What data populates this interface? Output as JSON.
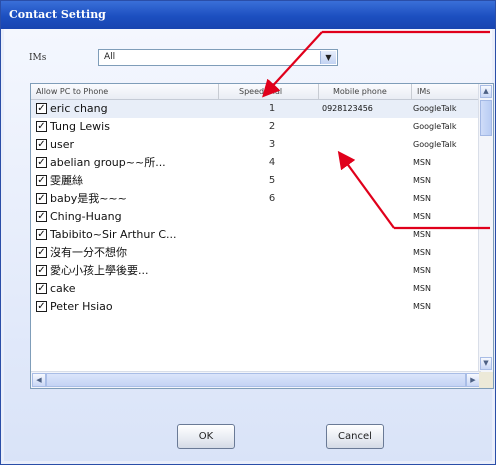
{
  "window": {
    "title": "Contact Setting"
  },
  "ims_filter": {
    "label": "IMs",
    "value": "All"
  },
  "list": {
    "columns": {
      "allow": "Allow PC to Phone",
      "speed_dial": "Speed Dial",
      "mobile": "Mobile phone",
      "ims": "IMs"
    },
    "rows": [
      {
        "name": "eric chang",
        "speed_dial": "1",
        "mobile": "0928123456",
        "ims": "GoogleTalk",
        "checked": true,
        "selected": true
      },
      {
        "name": "Tung Lewis",
        "speed_dial": "2",
        "mobile": "",
        "ims": "GoogleTalk",
        "checked": true,
        "selected": false
      },
      {
        "name": "user",
        "speed_dial": "3",
        "mobile": "",
        "ims": "GoogleTalk",
        "checked": true,
        "selected": false
      },
      {
        "name": "abelian group~~所...",
        "speed_dial": "4",
        "mobile": "",
        "ims": "MSN",
        "checked": true,
        "selected": false
      },
      {
        "name": "雯麗絲",
        "speed_dial": "5",
        "mobile": "",
        "ims": "MSN",
        "checked": true,
        "selected": false
      },
      {
        "name": "baby是我~~~",
        "speed_dial": "6",
        "mobile": "",
        "ims": "MSN",
        "checked": true,
        "selected": false
      },
      {
        "name": "Ching-Huang",
        "speed_dial": "",
        "mobile": "",
        "ims": "MSN",
        "checked": true,
        "selected": false
      },
      {
        "name": "Tabibito~Sir Arthur C...",
        "speed_dial": "",
        "mobile": "",
        "ims": "MSN",
        "checked": true,
        "selected": false
      },
      {
        "name": "沒有一分不想你",
        "speed_dial": "",
        "mobile": "",
        "ims": "MSN",
        "checked": true,
        "selected": false
      },
      {
        "name": "愛心小孩上學後要...",
        "speed_dial": "",
        "mobile": "",
        "ims": "MSN",
        "checked": true,
        "selected": false
      },
      {
        "name": "cake",
        "speed_dial": "",
        "mobile": "",
        "ims": "MSN",
        "checked": true,
        "selected": false
      },
      {
        "name": "Peter Hsiao",
        "speed_dial": "",
        "mobile": "",
        "ims": "MSN",
        "checked": true,
        "selected": false
      }
    ]
  },
  "buttons": {
    "ok": "OK",
    "cancel": "Cancel"
  },
  "colors": {
    "annotation_arrow": "#e0001b",
    "title_bar": "#1c4fc0"
  },
  "icons": {
    "dropdown": "chevron-down-icon",
    "scroll_up": "chevron-up-icon",
    "scroll_down": "chevron-down-icon",
    "scroll_left": "chevron-left-icon",
    "scroll_right": "chevron-right-icon",
    "checkbox": "checkmark-icon"
  }
}
